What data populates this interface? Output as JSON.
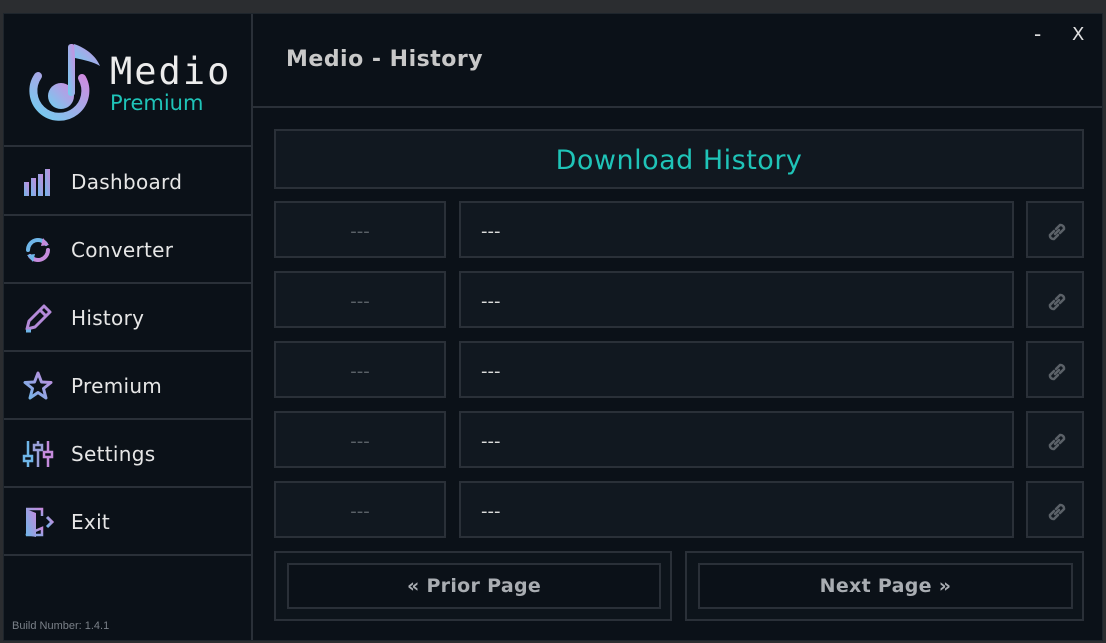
{
  "app": {
    "name": "Medio",
    "edition": "Premium",
    "build_label": "Build Number: 1.4.1"
  },
  "window": {
    "title": "Medio - History",
    "minimize_label": "-",
    "close_label": "X"
  },
  "sidebar": {
    "items": [
      {
        "label": "Dashboard",
        "icon": "bar-chart-icon"
      },
      {
        "label": "Converter",
        "icon": "refresh-icon"
      },
      {
        "label": "History",
        "icon": "pencil-icon"
      },
      {
        "label": "Premium",
        "icon": "star-icon"
      },
      {
        "label": "Settings",
        "icon": "sliders-icon"
      },
      {
        "label": "Exit",
        "icon": "exit-door-icon"
      }
    ]
  },
  "main": {
    "heading": "Download History",
    "rows": [
      {
        "date": "---",
        "name": "---",
        "link_icon": "link-icon"
      },
      {
        "date": "---",
        "name": "---",
        "link_icon": "link-icon"
      },
      {
        "date": "---",
        "name": "---",
        "link_icon": "link-icon"
      },
      {
        "date": "---",
        "name": "---",
        "link_icon": "link-icon"
      },
      {
        "date": "---",
        "name": "---",
        "link_icon": "link-icon"
      }
    ],
    "prior_label": "« Prior Page",
    "next_label": "Next Page »"
  },
  "colors": {
    "accent": "#1fc4b8",
    "background": "#0b1118",
    "panel": "#111820",
    "border": "#2a3038",
    "icon_gradient_start": "#6fb6e8",
    "icon_gradient_end": "#c58bdc"
  }
}
